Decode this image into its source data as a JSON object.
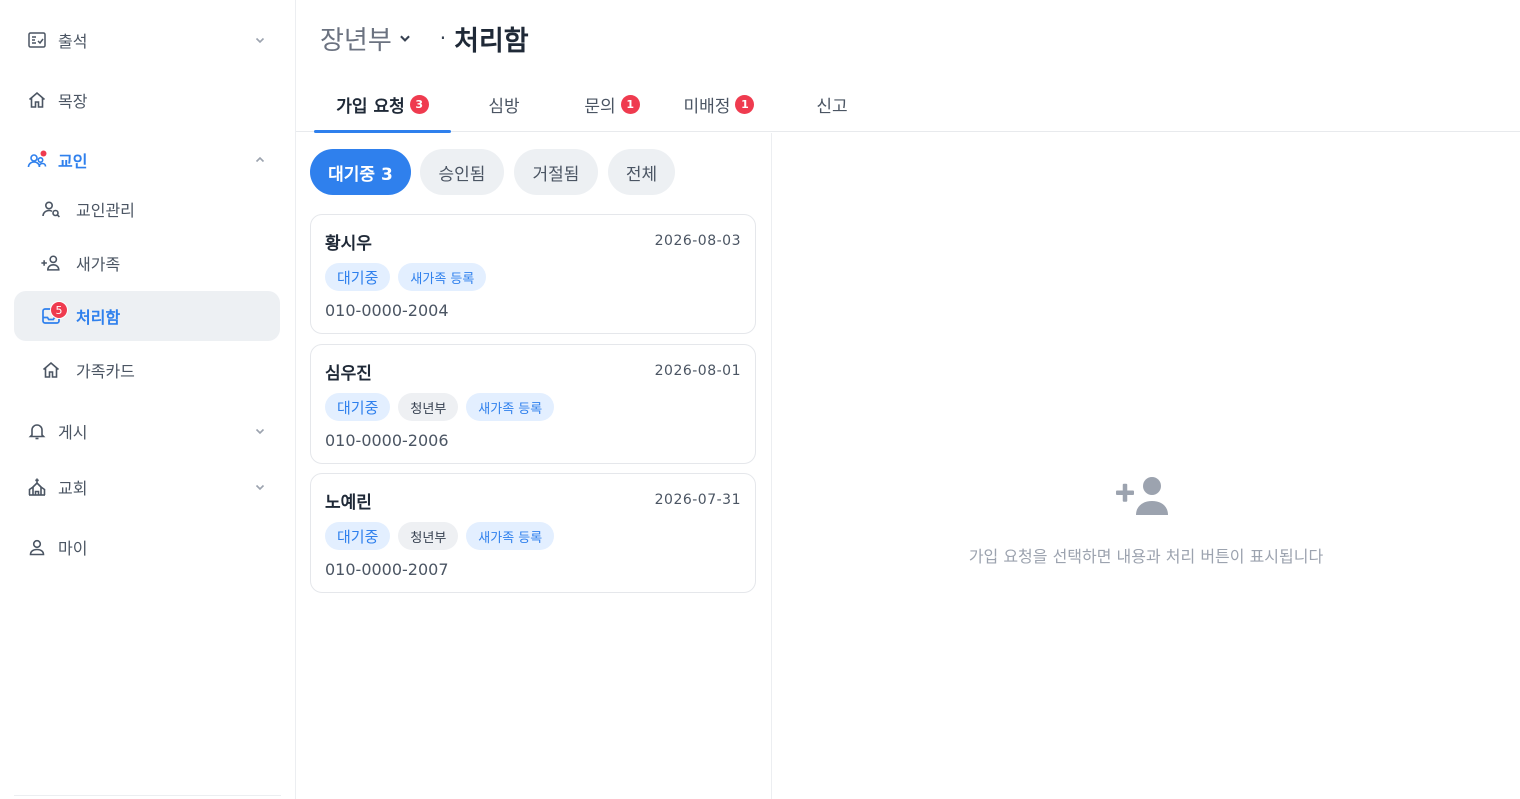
{
  "sidebar": {
    "items": [
      {
        "label": "출석",
        "icon": "checklist-icon"
      },
      {
        "label": "목장",
        "icon": "home-icon"
      },
      {
        "label": "교인",
        "icon": "people-icon"
      },
      {
        "label": "교인관리",
        "icon": "user-search-icon"
      },
      {
        "label": "새가족",
        "icon": "user-plus-icon"
      },
      {
        "label": "처리함",
        "icon": "inbox-icon",
        "badge": "5"
      },
      {
        "label": "가족카드",
        "icon": "home-icon"
      },
      {
        "label": "게시",
        "icon": "bell-icon"
      },
      {
        "label": "교회",
        "icon": "church-icon"
      },
      {
        "label": "마이",
        "icon": "user-icon"
      }
    ]
  },
  "header": {
    "department": "장년부",
    "separator": "·",
    "title": "처리함"
  },
  "tabs": [
    {
      "label": "가입 요청",
      "badge": "3"
    },
    {
      "label": "심방",
      "badge": ""
    },
    {
      "label": "문의",
      "badge": "1"
    },
    {
      "label": "미배정",
      "badge": "1"
    },
    {
      "label": "신고",
      "badge": ""
    }
  ],
  "filters": [
    {
      "label": "대기중 3"
    },
    {
      "label": "승인됨"
    },
    {
      "label": "거절됨"
    },
    {
      "label": "전체"
    }
  ],
  "requests": [
    {
      "name": "황시우",
      "date": "2026-08-03",
      "status": "대기중",
      "department": "",
      "kind": "새가족 등록",
      "phone": "010-0000-2004"
    },
    {
      "name": "심우진",
      "date": "2026-08-01",
      "status": "대기중",
      "department": "청년부",
      "kind": "새가족 등록",
      "phone": "010-0000-2006"
    },
    {
      "name": "노예린",
      "date": "2026-07-31",
      "status": "대기중",
      "department": "청년부",
      "kind": "새가족 등록",
      "phone": "010-0000-2007"
    }
  ],
  "detail": {
    "empty_icon": "user-plus-icon",
    "empty_message": "가입 요청을 선택하면 내용과 처리 버튼이 표시됩니다"
  },
  "colors": {
    "accent": "#2f80ed",
    "badge": "#ef3b4f",
    "muted": "#9ca3af"
  }
}
